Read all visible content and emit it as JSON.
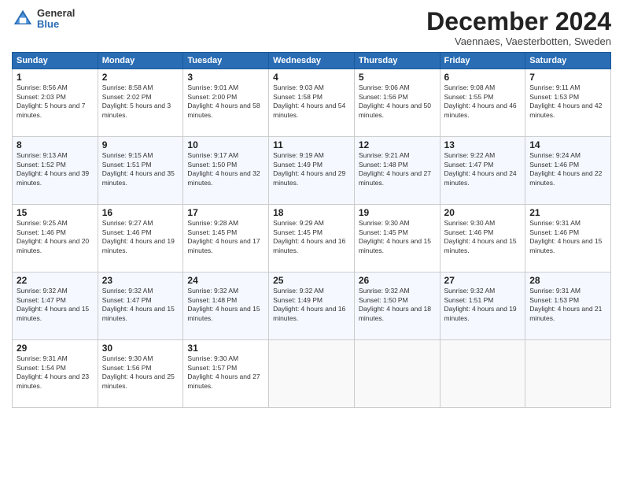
{
  "logo": {
    "general": "General",
    "blue": "Blue"
  },
  "header": {
    "month": "December 2024",
    "location": "Vaennaes, Vaesterbotten, Sweden"
  },
  "weekdays": [
    "Sunday",
    "Monday",
    "Tuesday",
    "Wednesday",
    "Thursday",
    "Friday",
    "Saturday"
  ],
  "weeks": [
    [
      {
        "day": "1",
        "sunrise": "8:56 AM",
        "sunset": "2:03 PM",
        "daylight": "5 hours and 7 minutes."
      },
      {
        "day": "2",
        "sunrise": "8:58 AM",
        "sunset": "2:02 PM",
        "daylight": "5 hours and 3 minutes."
      },
      {
        "day": "3",
        "sunrise": "9:01 AM",
        "sunset": "2:00 PM",
        "daylight": "4 hours and 58 minutes."
      },
      {
        "day": "4",
        "sunrise": "9:03 AM",
        "sunset": "1:58 PM",
        "daylight": "4 hours and 54 minutes."
      },
      {
        "day": "5",
        "sunrise": "9:06 AM",
        "sunset": "1:56 PM",
        "daylight": "4 hours and 50 minutes."
      },
      {
        "day": "6",
        "sunrise": "9:08 AM",
        "sunset": "1:55 PM",
        "daylight": "4 hours and 46 minutes."
      },
      {
        "day": "7",
        "sunrise": "9:11 AM",
        "sunset": "1:53 PM",
        "daylight": "4 hours and 42 minutes."
      }
    ],
    [
      {
        "day": "8",
        "sunrise": "9:13 AM",
        "sunset": "1:52 PM",
        "daylight": "4 hours and 39 minutes."
      },
      {
        "day": "9",
        "sunrise": "9:15 AM",
        "sunset": "1:51 PM",
        "daylight": "4 hours and 35 minutes."
      },
      {
        "day": "10",
        "sunrise": "9:17 AM",
        "sunset": "1:50 PM",
        "daylight": "4 hours and 32 minutes."
      },
      {
        "day": "11",
        "sunrise": "9:19 AM",
        "sunset": "1:49 PM",
        "daylight": "4 hours and 29 minutes."
      },
      {
        "day": "12",
        "sunrise": "9:21 AM",
        "sunset": "1:48 PM",
        "daylight": "4 hours and 27 minutes."
      },
      {
        "day": "13",
        "sunrise": "9:22 AM",
        "sunset": "1:47 PM",
        "daylight": "4 hours and 24 minutes."
      },
      {
        "day": "14",
        "sunrise": "9:24 AM",
        "sunset": "1:46 PM",
        "daylight": "4 hours and 22 minutes."
      }
    ],
    [
      {
        "day": "15",
        "sunrise": "9:25 AM",
        "sunset": "1:46 PM",
        "daylight": "4 hours and 20 minutes."
      },
      {
        "day": "16",
        "sunrise": "9:27 AM",
        "sunset": "1:46 PM",
        "daylight": "4 hours and 19 minutes."
      },
      {
        "day": "17",
        "sunrise": "9:28 AM",
        "sunset": "1:45 PM",
        "daylight": "4 hours and 17 minutes."
      },
      {
        "day": "18",
        "sunrise": "9:29 AM",
        "sunset": "1:45 PM",
        "daylight": "4 hours and 16 minutes."
      },
      {
        "day": "19",
        "sunrise": "9:30 AM",
        "sunset": "1:45 PM",
        "daylight": "4 hours and 15 minutes."
      },
      {
        "day": "20",
        "sunrise": "9:30 AM",
        "sunset": "1:46 PM",
        "daylight": "4 hours and 15 minutes."
      },
      {
        "day": "21",
        "sunrise": "9:31 AM",
        "sunset": "1:46 PM",
        "daylight": "4 hours and 15 minutes."
      }
    ],
    [
      {
        "day": "22",
        "sunrise": "9:32 AM",
        "sunset": "1:47 PM",
        "daylight": "4 hours and 15 minutes."
      },
      {
        "day": "23",
        "sunrise": "9:32 AM",
        "sunset": "1:47 PM",
        "daylight": "4 hours and 15 minutes."
      },
      {
        "day": "24",
        "sunrise": "9:32 AM",
        "sunset": "1:48 PM",
        "daylight": "4 hours and 15 minutes."
      },
      {
        "day": "25",
        "sunrise": "9:32 AM",
        "sunset": "1:49 PM",
        "daylight": "4 hours and 16 minutes."
      },
      {
        "day": "26",
        "sunrise": "9:32 AM",
        "sunset": "1:50 PM",
        "daylight": "4 hours and 18 minutes."
      },
      {
        "day": "27",
        "sunrise": "9:32 AM",
        "sunset": "1:51 PM",
        "daylight": "4 hours and 19 minutes."
      },
      {
        "day": "28",
        "sunrise": "9:31 AM",
        "sunset": "1:53 PM",
        "daylight": "4 hours and 21 minutes."
      }
    ],
    [
      {
        "day": "29",
        "sunrise": "9:31 AM",
        "sunset": "1:54 PM",
        "daylight": "4 hours and 23 minutes."
      },
      {
        "day": "30",
        "sunrise": "9:30 AM",
        "sunset": "1:56 PM",
        "daylight": "4 hours and 25 minutes."
      },
      {
        "day": "31",
        "sunrise": "9:30 AM",
        "sunset": "1:57 PM",
        "daylight": "4 hours and 27 minutes."
      },
      null,
      null,
      null,
      null
    ]
  ],
  "labels": {
    "sunrise": "Sunrise:",
    "sunset": "Sunset:",
    "daylight": "Daylight:"
  }
}
